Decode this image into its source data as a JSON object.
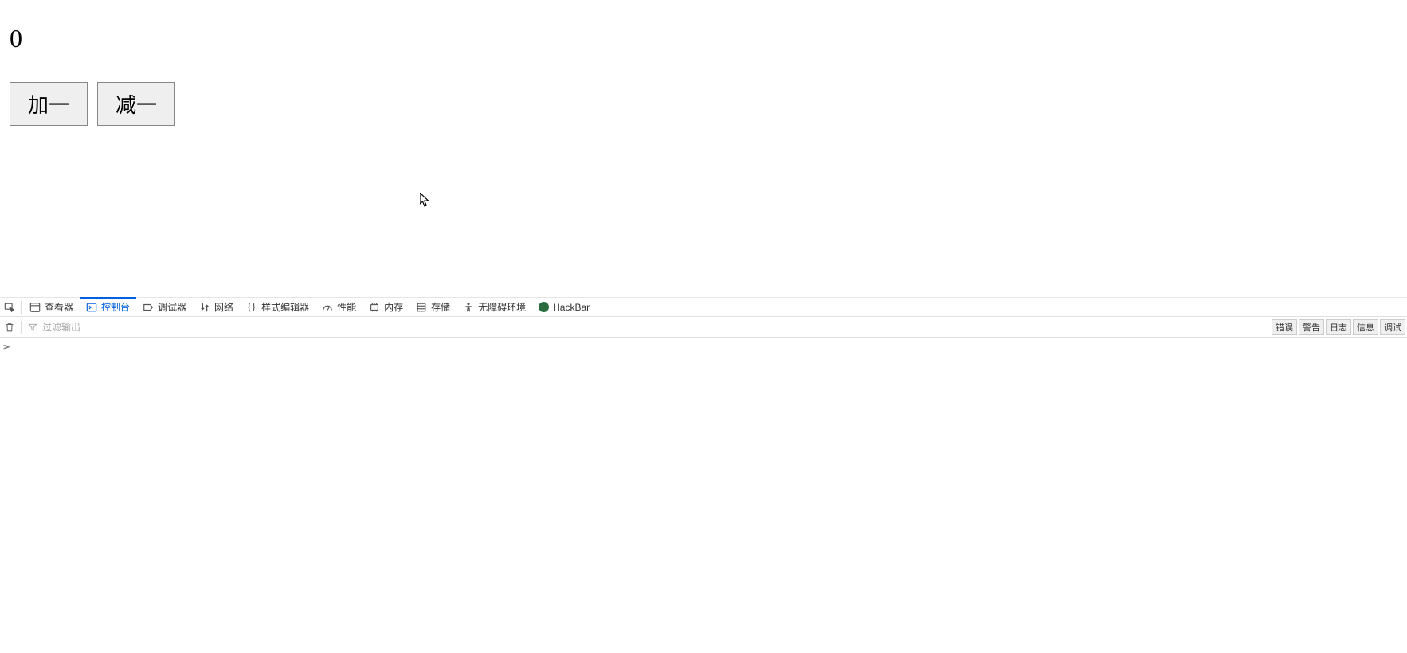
{
  "counter": {
    "value": "0"
  },
  "buttons": {
    "increment_label": "加一",
    "decrement_label": "减一"
  },
  "devtools": {
    "tabs": {
      "inspector": "查看器",
      "console": "控制台",
      "debugger": "调试器",
      "network": "网络",
      "style_editor": "样式编辑器",
      "performance": "性能",
      "memory": "内存",
      "storage": "存储",
      "accessibility": "无障碍环境",
      "hackbar": "HackBar"
    },
    "filter": {
      "placeholder": "过滤输出"
    },
    "filter_buttons": {
      "errors": "错误",
      "warnings": "警告",
      "logs": "日志",
      "info": "信息",
      "debug": "调试"
    }
  }
}
